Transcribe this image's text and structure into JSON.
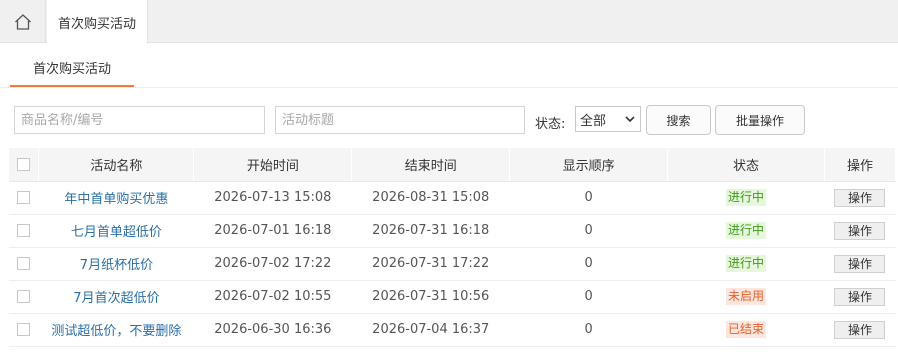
{
  "top_tabs": [
    {
      "label": "首次购买活动"
    }
  ],
  "sub_tabs": [
    {
      "label": "首次购买活动"
    }
  ],
  "filters": {
    "goods_placeholder": "商品名称/编号",
    "title_placeholder": "活动标题",
    "status_label": "状态:",
    "status_value": "全部",
    "search_label": "搜索",
    "batch_label": "批量操作"
  },
  "table": {
    "headers": [
      "活动名称",
      "开始时间",
      "结束时间",
      "显示顺序",
      "状态",
      "操作"
    ],
    "rows": [
      {
        "name": "年中首单购买优惠",
        "start": "2026-07-13 15:08",
        "end": "2026-08-31 15:08",
        "order": "0",
        "status": "进行中",
        "action": "操作"
      },
      {
        "name": "七月首单超低价",
        "start": "2026-07-01 16:18",
        "end": "2026-07-31 16:18",
        "order": "0",
        "status": "进行中",
        "action": "操作"
      },
      {
        "name": "7月纸杯低价",
        "start": "2026-07-02 17:22",
        "end": "2026-07-31 17:22",
        "order": "0",
        "status": "进行中",
        "action": "操作"
      },
      {
        "name": "7月首次超低价",
        "start": "2026-07-02 10:55",
        "end": "2026-07-31 10:56",
        "order": "0",
        "status": "未启用",
        "action": "操作"
      },
      {
        "name": "测试超低价，不要删除",
        "start": "2026-06-30 16:36",
        "end": "2026-07-04 16:37",
        "order": "0",
        "status": "已结束",
        "action": "操作"
      }
    ]
  },
  "colors": {
    "accent": "#f07c3a",
    "link": "#2a6fa8",
    "running": "#3f9b1e",
    "inactive": "#e4612f"
  },
  "icons": {
    "home": "home-icon",
    "select": "chevron-down-icon"
  }
}
